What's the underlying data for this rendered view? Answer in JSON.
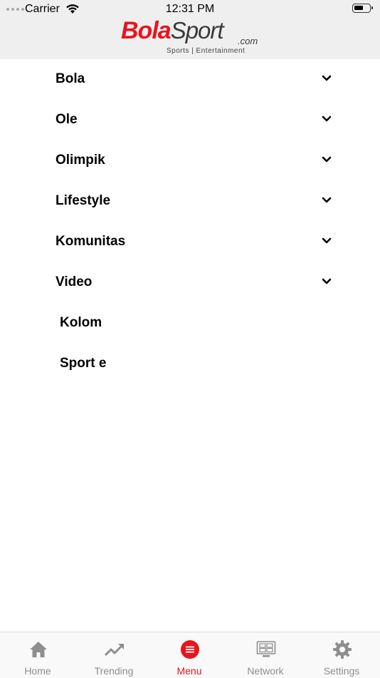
{
  "status_bar": {
    "carrier": "Carrier",
    "time": "12:31 PM"
  },
  "header": {
    "logo_bola": "Bola",
    "logo_sport": "Sport",
    "logo_com": ".com",
    "logo_tagline": "Sports | Entertainment"
  },
  "menu": {
    "items": [
      {
        "label": "Bola",
        "expandable": true
      },
      {
        "label": "Ole",
        "expandable": true
      },
      {
        "label": "Olimpik",
        "expandable": true
      },
      {
        "label": "Lifestyle",
        "expandable": true
      },
      {
        "label": "Komunitas",
        "expandable": true
      },
      {
        "label": "Video",
        "expandable": true
      },
      {
        "label": "Kolom",
        "expandable": false
      },
      {
        "label": "Sport e",
        "expandable": false
      }
    ]
  },
  "tab_bar": {
    "active_color": "#e8141c",
    "inactive_color": "#8e8e8e",
    "tabs": [
      {
        "label": "Home",
        "icon": "home-icon",
        "active": false
      },
      {
        "label": "Trending",
        "icon": "trending-icon",
        "active": false
      },
      {
        "label": "Menu",
        "icon": "menu-icon",
        "active": true
      },
      {
        "label": "Network",
        "icon": "network-icon",
        "active": false
      },
      {
        "label": "Settings",
        "icon": "gear-icon",
        "active": false
      }
    ]
  }
}
